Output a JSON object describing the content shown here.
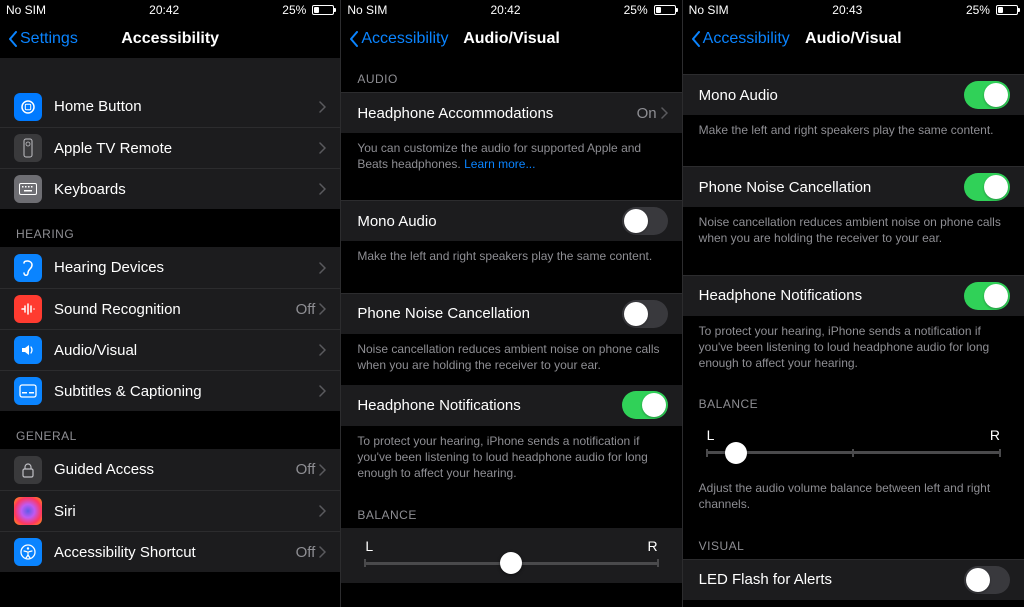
{
  "status": {
    "carrier": "No SIM",
    "battery_pct": "25%"
  },
  "panel1": {
    "time": "20:42",
    "back_label": "Settings",
    "title": "Accessibility",
    "rows_physical": [
      {
        "icon": "ic-homebutton",
        "label": "Home Button"
      },
      {
        "icon": "ic-appletv",
        "label": "Apple TV Remote"
      },
      {
        "icon": "ic-keyboards",
        "label": "Keyboards"
      }
    ],
    "section_hearing": "HEARING",
    "rows_hearing": [
      {
        "icon": "ic-hearing",
        "label": "Hearing Devices",
        "value": ""
      },
      {
        "icon": "ic-sound",
        "label": "Sound Recognition",
        "value": "Off"
      },
      {
        "icon": "ic-audio",
        "label": "Audio/Visual",
        "value": ""
      },
      {
        "icon": "ic-subtitles",
        "label": "Subtitles & Captioning",
        "value": ""
      }
    ],
    "section_general": "GENERAL",
    "rows_general": [
      {
        "icon": "ic-guided",
        "label": "Guided Access",
        "value": "Off"
      },
      {
        "icon": "ic-siri",
        "label": "Siri",
        "value": ""
      },
      {
        "icon": "ic-shortcut",
        "label": "Accessibility Shortcut",
        "value": "Off"
      }
    ]
  },
  "panel2": {
    "time": "20:42",
    "back_label": "Accessibility",
    "title": "Audio/Visual",
    "section_audio": "AUDIO",
    "headphone_accom": {
      "label": "Headphone Accommodations",
      "value": "On"
    },
    "headphone_footer": "You can customize the audio for supported Apple and Beats headphones. ",
    "headphone_footer_link": "Learn more...",
    "mono": {
      "label": "Mono Audio",
      "on": false
    },
    "mono_footer": "Make the left and right speakers play the same content.",
    "noise": {
      "label": "Phone Noise Cancellation",
      "on": false
    },
    "noise_footer": "Noise cancellation reduces ambient noise on phone calls when you are holding the receiver to your ear.",
    "notif": {
      "label": "Headphone Notifications",
      "on": true
    },
    "notif_footer": "To protect your hearing, iPhone sends a notification if you've been listening to loud headphone audio for long enough to affect your hearing.",
    "section_balance": "BALANCE",
    "balance": {
      "left": "L",
      "right": "R",
      "position_pct": 50
    }
  },
  "panel3": {
    "time": "20:43",
    "back_label": "Accessibility",
    "title": "Audio/Visual",
    "mono": {
      "label": "Mono Audio",
      "on": true
    },
    "mono_footer": "Make the left and right speakers play the same content.",
    "noise": {
      "label": "Phone Noise Cancellation",
      "on": true
    },
    "noise_footer": "Noise cancellation reduces ambient noise on phone calls when you are holding the receiver to your ear.",
    "notif": {
      "label": "Headphone Notifications",
      "on": true
    },
    "notif_footer": "To protect your hearing, iPhone sends a notification if you've been listening to loud headphone audio for long enough to affect your hearing.",
    "section_balance": "BALANCE",
    "balance": {
      "left": "L",
      "right": "R",
      "position_pct": 10
    },
    "balance_footer": "Adjust the audio volume balance between left and right channels.",
    "section_visual": "VISUAL",
    "led": {
      "label": "LED Flash for Alerts",
      "on": false
    }
  }
}
